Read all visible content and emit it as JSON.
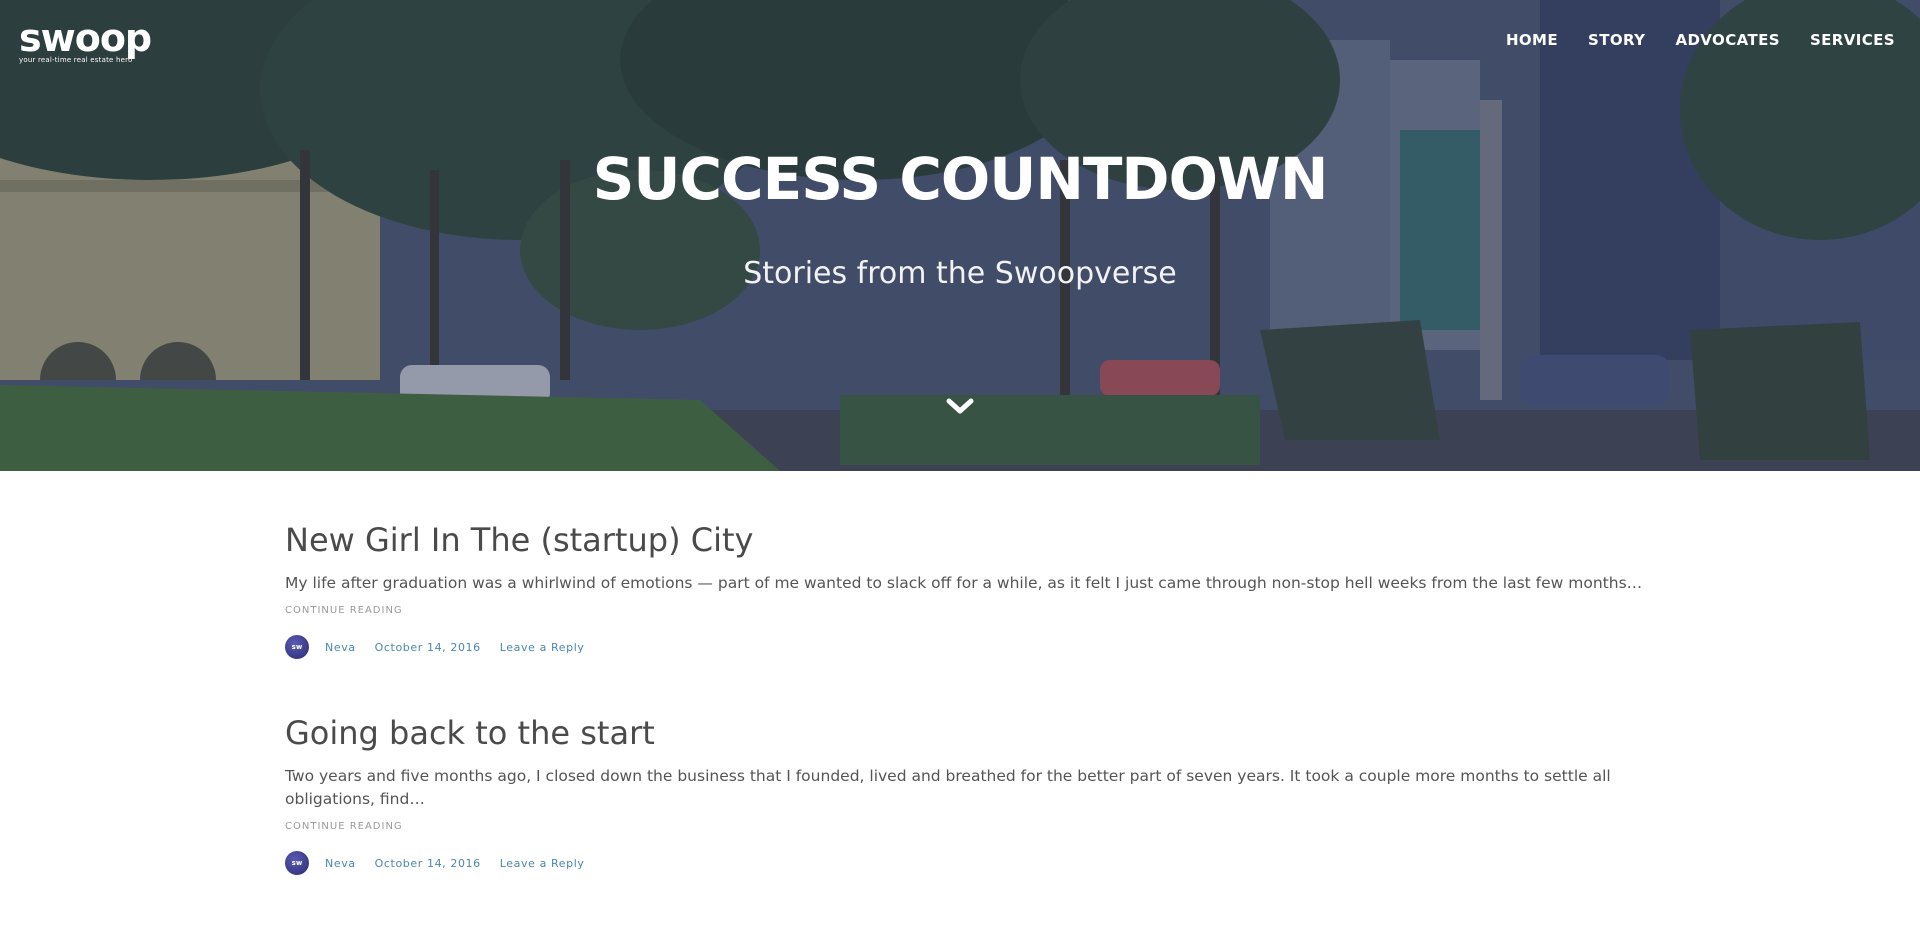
{
  "brand": {
    "logo_text": "swoop",
    "tagline": "your real-time real estate hero"
  },
  "nav": {
    "items": [
      "HOME",
      "STORY",
      "ADVOCATES",
      "SERVICES"
    ]
  },
  "hero": {
    "title": "SUCCESS COUNTDOWN",
    "subtitle": "Stories from the Swoopverse",
    "scroll_icon": "chevron-down-icon"
  },
  "posts": [
    {
      "title": "New Girl In The (startup) City",
      "excerpt": "My life after graduation was a whirlwind of emotions — part of me wanted to slack off for a while, as it felt I just came through non-stop hell weeks from the last few months…",
      "continue_label": "CONTINUE READING",
      "author": "Neva",
      "date": "October 14, 2016",
      "reply_label": "Leave a Reply",
      "avatar_text": "sw"
    },
    {
      "title": "Going back to the start",
      "excerpt": "Two years and five months ago, I closed down the business that I founded, lived and breathed for the better part of seven years. It took a couple more months to settle all obligations, find…",
      "continue_label": "CONTINUE READING",
      "author": "Neva",
      "date": "October 14, 2016",
      "reply_label": "Leave a Reply",
      "avatar_text": "sw"
    }
  ],
  "colors": {
    "link": "#4a87b0",
    "title_text": "#4a4a4a",
    "overlay": "#282c50"
  }
}
